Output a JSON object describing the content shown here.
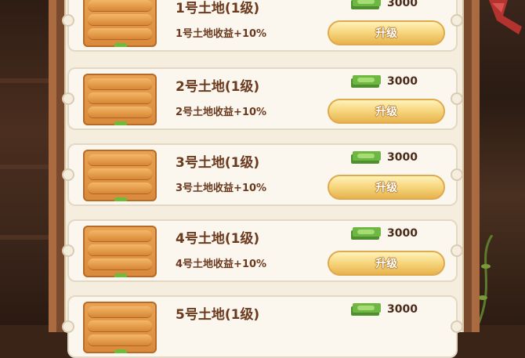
{
  "colors": {
    "panel_frame": "#a96b3f",
    "card_bg": "#fbf7ee",
    "text_brown": "#6b3a1e",
    "button_gold": "#f6d57c"
  },
  "currency_icon": "cash-stack-icon",
  "lands": [
    {
      "title": "1号土地(1级)",
      "desc": "1号土地收益+10%",
      "price": "3000",
      "button": "升级"
    },
    {
      "title": "2号土地(1级)",
      "desc": "2号土地收益+10%",
      "price": "3000",
      "button": "升级"
    },
    {
      "title": "3号土地(1级)",
      "desc": "3号土地收益+10%",
      "price": "3000",
      "button": "升级"
    },
    {
      "title": "4号土地(1级)",
      "desc": "4号土地收益+10%",
      "price": "3000",
      "button": "升级"
    },
    {
      "title": "5号土地(1级)",
      "price": "3000"
    }
  ]
}
